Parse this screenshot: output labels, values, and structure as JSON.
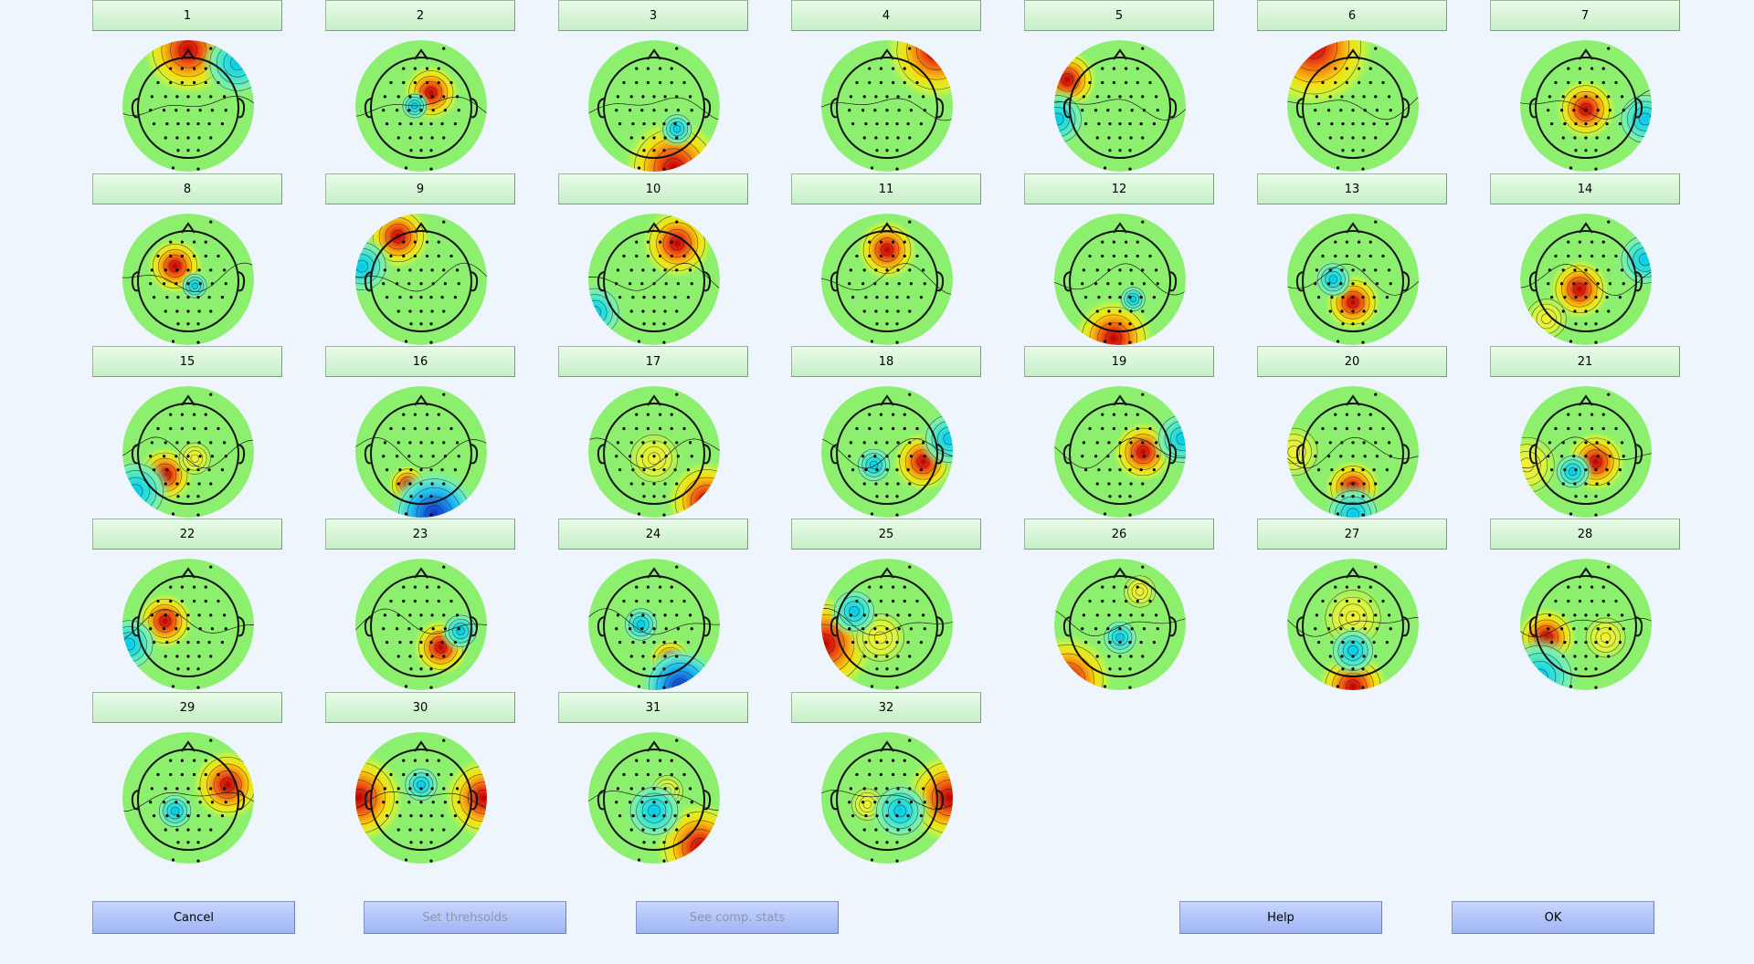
{
  "components": [
    {
      "label": "1",
      "topo": "topomap-1"
    },
    {
      "label": "2",
      "topo": "topomap-2"
    },
    {
      "label": "3",
      "topo": "topomap-3"
    },
    {
      "label": "4",
      "topo": "topomap-4"
    },
    {
      "label": "5",
      "topo": "topomap-5"
    },
    {
      "label": "6",
      "topo": "topomap-6"
    },
    {
      "label": "7",
      "topo": "topomap-7"
    },
    {
      "label": "8",
      "topo": "topomap-8"
    },
    {
      "label": "9",
      "topo": "topomap-9"
    },
    {
      "label": "10",
      "topo": "topomap-10"
    },
    {
      "label": "11",
      "topo": "topomap-11"
    },
    {
      "label": "12",
      "topo": "topomap-12"
    },
    {
      "label": "13",
      "topo": "topomap-13"
    },
    {
      "label": "14",
      "topo": "topomap-14"
    },
    {
      "label": "15",
      "topo": "topomap-15"
    },
    {
      "label": "16",
      "topo": "topomap-16"
    },
    {
      "label": "17",
      "topo": "topomap-17"
    },
    {
      "label": "18",
      "topo": "topomap-18"
    },
    {
      "label": "19",
      "topo": "topomap-19"
    },
    {
      "label": "20",
      "topo": "topomap-20"
    },
    {
      "label": "21",
      "topo": "topomap-21"
    },
    {
      "label": "22",
      "topo": "topomap-22"
    },
    {
      "label": "23",
      "topo": "topomap-23"
    },
    {
      "label": "24",
      "topo": "topomap-24"
    },
    {
      "label": "25",
      "topo": "topomap-25"
    },
    {
      "label": "26",
      "topo": "topomap-26"
    },
    {
      "label": "27",
      "topo": "topomap-27"
    },
    {
      "label": "28",
      "topo": "topomap-28"
    },
    {
      "label": "29",
      "topo": "topomap-29"
    },
    {
      "label": "30",
      "topo": "topomap-30"
    },
    {
      "label": "31",
      "topo": "topomap-31"
    },
    {
      "label": "32",
      "topo": "topomap-32"
    }
  ],
  "buttons": {
    "cancel": "Cancel",
    "set_thresholds": "Set threhsolds",
    "see_comp_stats": "See comp. stats",
    "help": "Help",
    "ok": "OK"
  },
  "colors": {
    "background": "#eef5fc",
    "component_button": "#d6f5d6",
    "action_button": "#b3c6fa",
    "disabled_text": "#8b96ad"
  },
  "blob_defs": [
    [
      [
        0.0,
        -0.85,
        0.45,
        "h"
      ],
      [
        0.75,
        -0.65,
        0.35,
        "c"
      ]
    ],
    [
      [
        0.15,
        -0.2,
        0.28,
        "h"
      ],
      [
        -0.1,
        0.0,
        0.15,
        "c"
      ]
    ],
    [
      [
        0.3,
        0.95,
        0.5,
        "h"
      ],
      [
        0.35,
        0.35,
        0.18,
        "c"
      ]
    ],
    [
      [
        0.75,
        -0.85,
        0.5,
        "h"
      ]
    ],
    [
      [
        -0.8,
        -0.4,
        0.3,
        "h"
      ],
      [
        -0.95,
        0.2,
        0.3,
        "c"
      ]
    ],
    [
      [
        -0.6,
        -0.9,
        0.6,
        "h"
      ]
    ],
    [
      [
        0.0,
        0.05,
        0.3,
        "h"
      ],
      [
        0.9,
        0.2,
        0.3,
        "c"
      ]
    ],
    [
      [
        -0.2,
        -0.2,
        0.28,
        "h"
      ],
      [
        0.1,
        0.1,
        0.15,
        "c"
      ]
    ],
    [
      [
        -0.35,
        -0.65,
        0.32,
        "h"
      ],
      [
        -0.9,
        -0.2,
        0.3,
        "c"
      ]
    ],
    [
      [
        0.35,
        -0.55,
        0.35,
        "h"
      ],
      [
        -0.9,
        0.5,
        0.3,
        "c"
      ]
    ],
    [
      [
        0.0,
        -0.45,
        0.3,
        "h"
      ]
    ],
    [
      [
        -0.1,
        0.9,
        0.4,
        "h"
      ],
      [
        0.2,
        0.3,
        0.15,
        "c"
      ]
    ],
    [
      [
        0.0,
        0.35,
        0.28,
        "h"
      ],
      [
        -0.3,
        0.0,
        0.2,
        "c"
      ]
    ],
    [
      [
        -0.1,
        0.15,
        0.3,
        "h"
      ],
      [
        -0.6,
        0.6,
        0.25,
        "y"
      ],
      [
        0.9,
        -0.3,
        0.3,
        "c"
      ]
    ],
    [
      [
        -0.35,
        0.35,
        0.28,
        "h"
      ],
      [
        -0.8,
        0.6,
        0.35,
        "c"
      ],
      [
        0.1,
        0.1,
        0.2,
        "y"
      ]
    ],
    [
      [
        -0.2,
        0.5,
        0.2,
        "h"
      ],
      [
        0.2,
        0.95,
        0.45,
        "b"
      ]
    ],
    [
      [
        0.8,
        0.75,
        0.4,
        "h"
      ],
      [
        0.0,
        0.1,
        0.3,
        "y"
      ]
    ],
    [
      [
        0.55,
        0.15,
        0.3,
        "h"
      ],
      [
        0.95,
        -0.2,
        0.3,
        "c"
      ],
      [
        -0.2,
        0.2,
        0.2,
        "c"
      ]
    ],
    [
      [
        0.35,
        0.0,
        0.3,
        "h"
      ],
      [
        0.95,
        -0.2,
        0.3,
        "c"
      ]
    ],
    [
      [
        0.0,
        0.55,
        0.28,
        "h"
      ],
      [
        0.0,
        0.95,
        0.3,
        "c"
      ],
      [
        -0.9,
        0.0,
        0.3,
        "y"
      ]
    ],
    [
      [
        0.15,
        0.15,
        0.3,
        "h"
      ],
      [
        -0.9,
        0.2,
        0.35,
        "y"
      ],
      [
        -0.2,
        0.3,
        0.2,
        "c"
      ]
    ],
    [
      [
        -0.35,
        -0.05,
        0.28,
        "h"
      ],
      [
        -0.9,
        0.3,
        0.3,
        "c"
      ]
    ],
    [
      [
        0.3,
        0.35,
        0.28,
        "h"
      ],
      [
        0.6,
        0.1,
        0.2,
        "c"
      ]
    ],
    [
      [
        0.25,
        0.55,
        0.22,
        "h"
      ],
      [
        0.4,
        0.95,
        0.4,
        "b"
      ],
      [
        -0.2,
        0.0,
        0.2,
        "c"
      ]
    ],
    [
      [
        -0.95,
        0.3,
        0.5,
        "h"
      ],
      [
        -0.1,
        0.2,
        0.3,
        "y"
      ],
      [
        -0.5,
        -0.2,
        0.25,
        "c"
      ]
    ],
    [
      [
        -0.8,
        0.85,
        0.45,
        "h"
      ],
      [
        0.3,
        -0.5,
        0.2,
        "y"
      ],
      [
        0.0,
        0.2,
        0.2,
        "c"
      ]
    ],
    [
      [
        0.0,
        0.95,
        0.35,
        "h"
      ],
      [
        0.0,
        -0.1,
        0.35,
        "y"
      ],
      [
        0.0,
        0.4,
        0.25,
        "c"
      ]
    ],
    [
      [
        -0.6,
        0.2,
        0.3,
        "h"
      ],
      [
        -0.7,
        0.8,
        0.4,
        "c"
      ],
      [
        0.3,
        0.2,
        0.25,
        "y"
      ]
    ],
    [
      [
        0.6,
        -0.2,
        0.35,
        "h"
      ],
      [
        -0.2,
        0.2,
        0.2,
        "c"
      ]
    ],
    [
      [
        -0.95,
        0.0,
        0.45,
        "h"
      ],
      [
        0.95,
        0.0,
        0.4,
        "h"
      ],
      [
        0.0,
        -0.2,
        0.2,
        "c"
      ]
    ],
    [
      [
        0.7,
        0.75,
        0.45,
        "h"
      ],
      [
        0.2,
        -0.1,
        0.2,
        "y"
      ],
      [
        0.0,
        0.2,
        0.3,
        "c"
      ]
    ],
    [
      [
        0.95,
        0.0,
        0.45,
        "h"
      ],
      [
        -0.3,
        0.1,
        0.2,
        "y"
      ],
      [
        0.2,
        0.2,
        0.3,
        "c"
      ]
    ]
  ]
}
